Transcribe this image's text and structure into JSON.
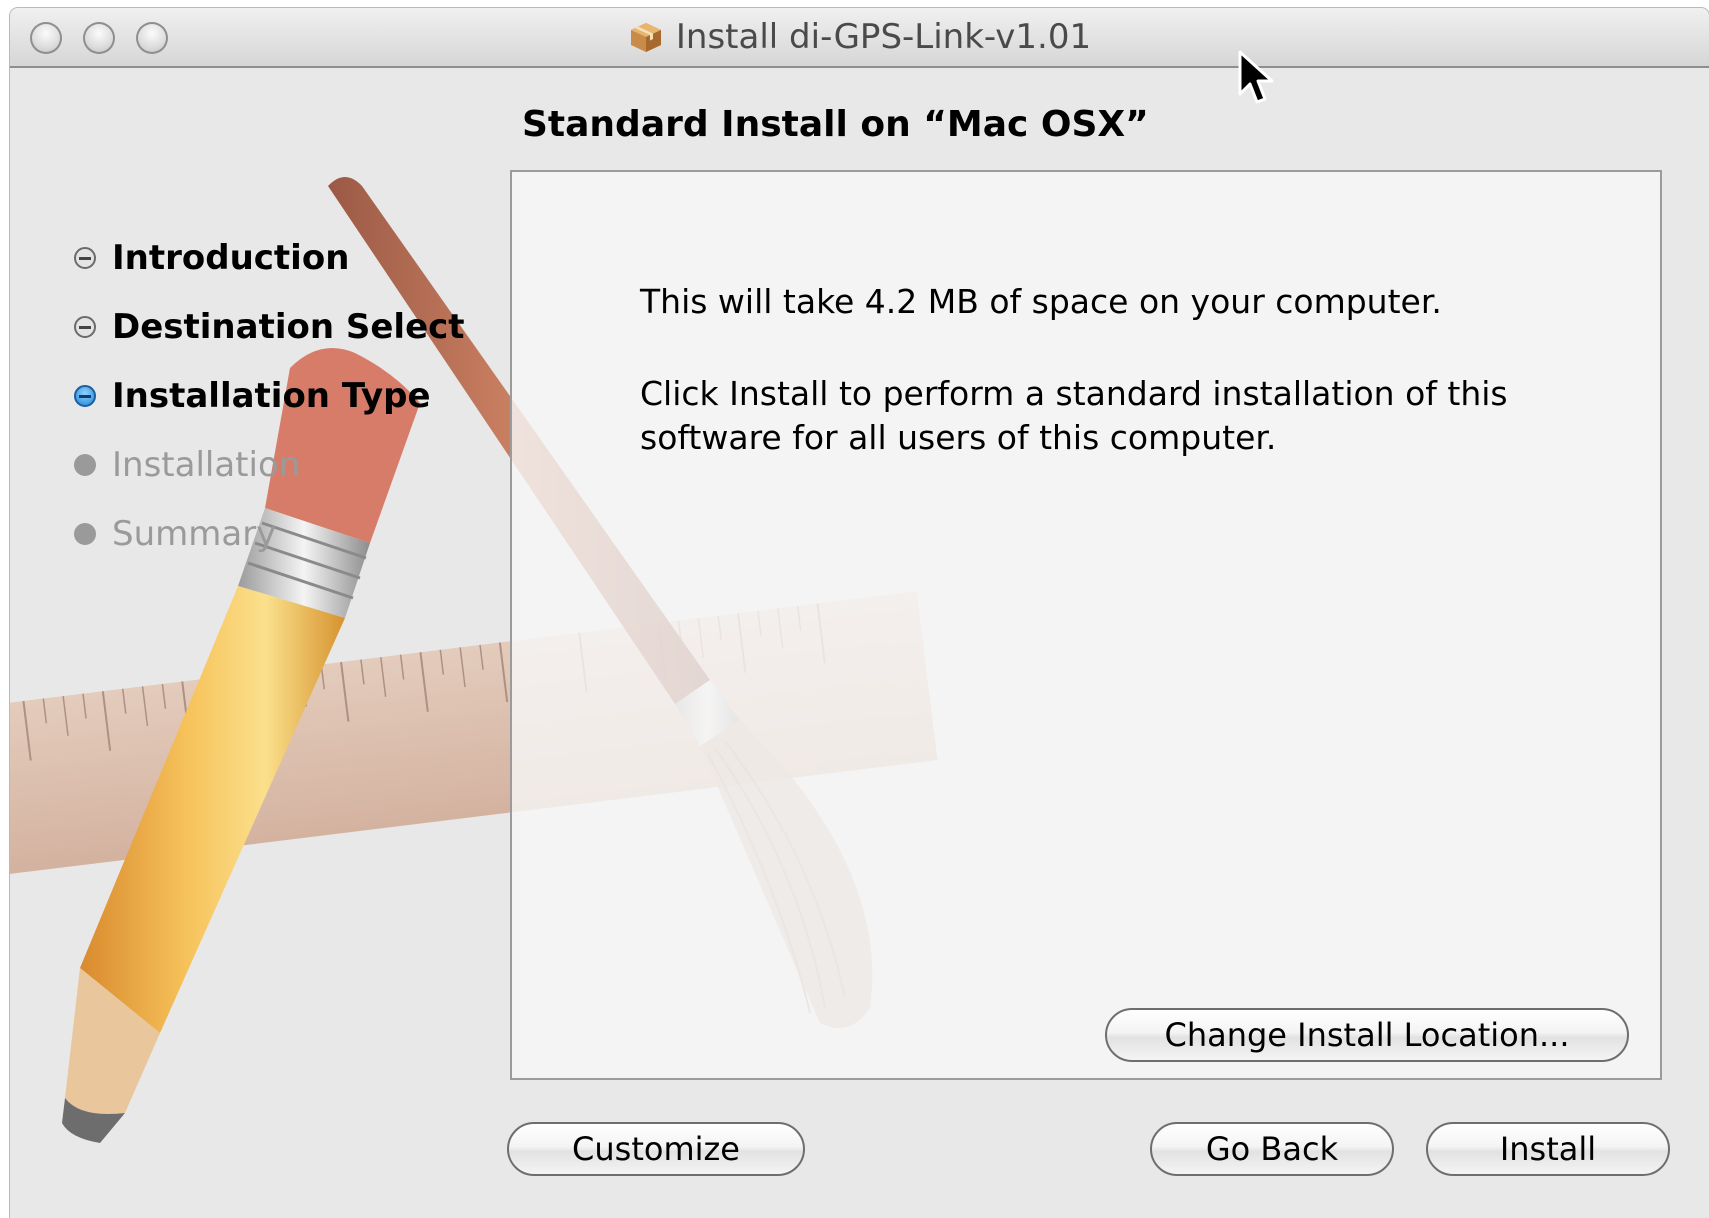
{
  "window": {
    "title": "Install di-GPS-Link-v1.01"
  },
  "heading": "Standard Install on “Mac OSX”",
  "steps": [
    {
      "label": "Introduction",
      "state": "done"
    },
    {
      "label": "Destination Select",
      "state": "done"
    },
    {
      "label": "Installation Type",
      "state": "current"
    },
    {
      "label": "Installation",
      "state": "pending"
    },
    {
      "label": "Summary",
      "state": "pending"
    }
  ],
  "content": {
    "space_text": "This will take 4.2 MB of space on your computer.",
    "install_info": "Click Install to perform a standard installation of this software for all users of this computer."
  },
  "buttons": {
    "change_location": "Change Install Location...",
    "customize": "Customize",
    "go_back": "Go Back",
    "install": "Install"
  },
  "icons": {
    "window_icon": "package-icon",
    "traffic_lights": [
      "close-button",
      "minimize-button",
      "zoom-button"
    ],
    "background_art": [
      "pencil-icon",
      "brush-icon",
      "ruler-icon"
    ]
  },
  "colors": {
    "current_step": "#2386d6",
    "pending_step": "#9a9a9a",
    "window_bg": "#e8e8e8"
  }
}
